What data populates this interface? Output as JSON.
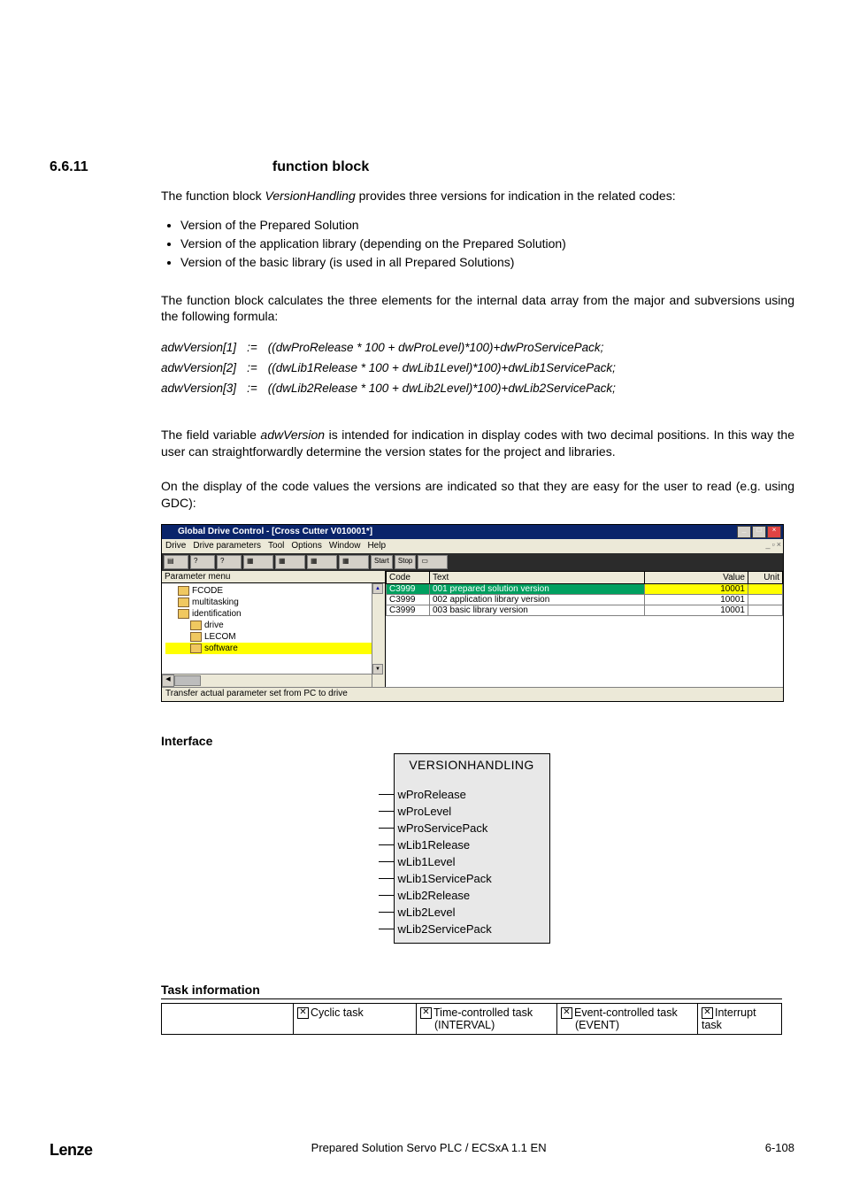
{
  "heading": {
    "number": "6.6.11",
    "title": "function block"
  },
  "intro": "The function block VersionHandling provides three versions for indication in the related codes:",
  "intro_em": "VersionHandling",
  "bullets": [
    "Version of the Prepared Solution",
    "Version of the application library (depending on the Prepared Solution)",
    "Version of the basic library (is used in all Prepared Solutions)"
  ],
  "para1": "The function block calculates the three elements for the internal data array from the major and subversions using the following formula:",
  "formulas": [
    {
      "lhs": "adwVersion[1]",
      "op": ":=",
      "rhs": "((dwProRelease * 100 + dwProLevel)*100)+dwProServicePack;"
    },
    {
      "lhs": "adwVersion[2]",
      "op": ":=",
      "rhs": "((dwLib1Release * 100 + dwLib1Level)*100)+dwLib1ServicePack;"
    },
    {
      "lhs": "adwVersion[3]",
      "op": ":=",
      "rhs": "((dwLib2Release * 100 + dwLib2Level)*100)+dwLib2ServicePack;"
    }
  ],
  "para2a": "The field variable ",
  "para2_em": "adwVersion",
  "para2b": " is intended for indication in display codes with two decimal positions. In this way the user can straightforwardly determine the version states for the project and libraries.",
  "para3": "On the display of the code values the versions are indicated so that they are easy for the user to read (e.g. using GDC):",
  "gdc": {
    "title": "Global Drive Control - [Cross Cutter V010001*]",
    "menus": [
      "Drive",
      "Drive parameters",
      "Tool",
      "Options",
      "Window",
      "Help"
    ],
    "toolbar": {
      "start": "Start",
      "stop": "Stop"
    },
    "tree_header": "Parameter menu",
    "tree": [
      "FCODE",
      "multitasking",
      "identification",
      "drive",
      "LECOM",
      "software"
    ],
    "grid_headers": {
      "code": "Code",
      "text": "Text",
      "value": "Value",
      "unit": "Unit"
    },
    "grid_rows": [
      {
        "code": "C3999",
        "text": "001  prepared solution version",
        "value": "10001"
      },
      {
        "code": "C3999",
        "text": "002  application library version",
        "value": "10001"
      },
      {
        "code": "C3999",
        "text": "003  basic library version",
        "value": "10001"
      }
    ],
    "status": "Transfer actual parameter set from PC to drive"
  },
  "interface_label": "Interface",
  "fb": {
    "title": "VERSIONHANDLING",
    "pins": [
      "wProRelease",
      "wProLevel",
      "wProServicePack",
      "wLib1Release",
      "wLib1Level",
      "wLib1ServicePack",
      "wLib2Release",
      "wLib2Level",
      "wLib2ServicePack"
    ]
  },
  "task_label": "Task information",
  "tasks": {
    "cyclic": "Cyclic task",
    "time": "Time-controlled task",
    "time_sub": "(INTERVAL)",
    "event": "Event-controlled task",
    "event_sub": "(EVENT)",
    "interrupt": "Interrupt task"
  },
  "footer": {
    "brand": "Lenze",
    "mid": "Prepared Solution Servo PLC / ECSxA 1.1 EN",
    "page": "6-108"
  }
}
